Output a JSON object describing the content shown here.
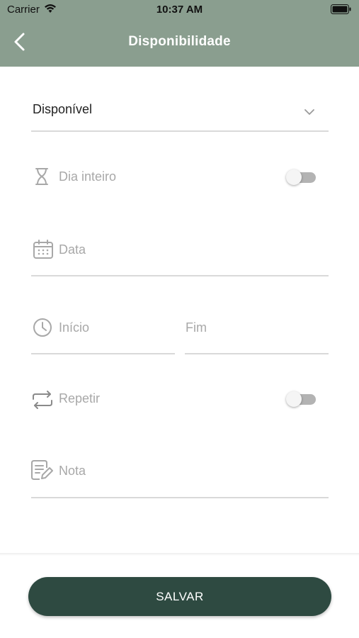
{
  "status_bar": {
    "carrier": "Carrier",
    "time": "10:37 AM"
  },
  "header": {
    "title": "Disponibilidade",
    "back_icon": "chevron-left-icon",
    "background_color": "#8a9e8f"
  },
  "form": {
    "status_select": {
      "value": "Disponível",
      "icon": "chevron-down-icon"
    },
    "all_day": {
      "label": "Dia inteiro",
      "icon": "hourglass-icon",
      "toggle_on": false
    },
    "date": {
      "placeholder": "Data",
      "icon": "calendar-icon"
    },
    "start": {
      "placeholder": "Início",
      "icon": "clock-icon"
    },
    "end": {
      "placeholder": "Fim"
    },
    "repeat": {
      "label": "Repetir",
      "icon": "repeat-icon",
      "toggle_on": false
    },
    "note": {
      "placeholder": "Nota",
      "icon": "note-edit-icon"
    }
  },
  "footer": {
    "save_label": "SALVAR",
    "button_color": "#2e4a41"
  }
}
